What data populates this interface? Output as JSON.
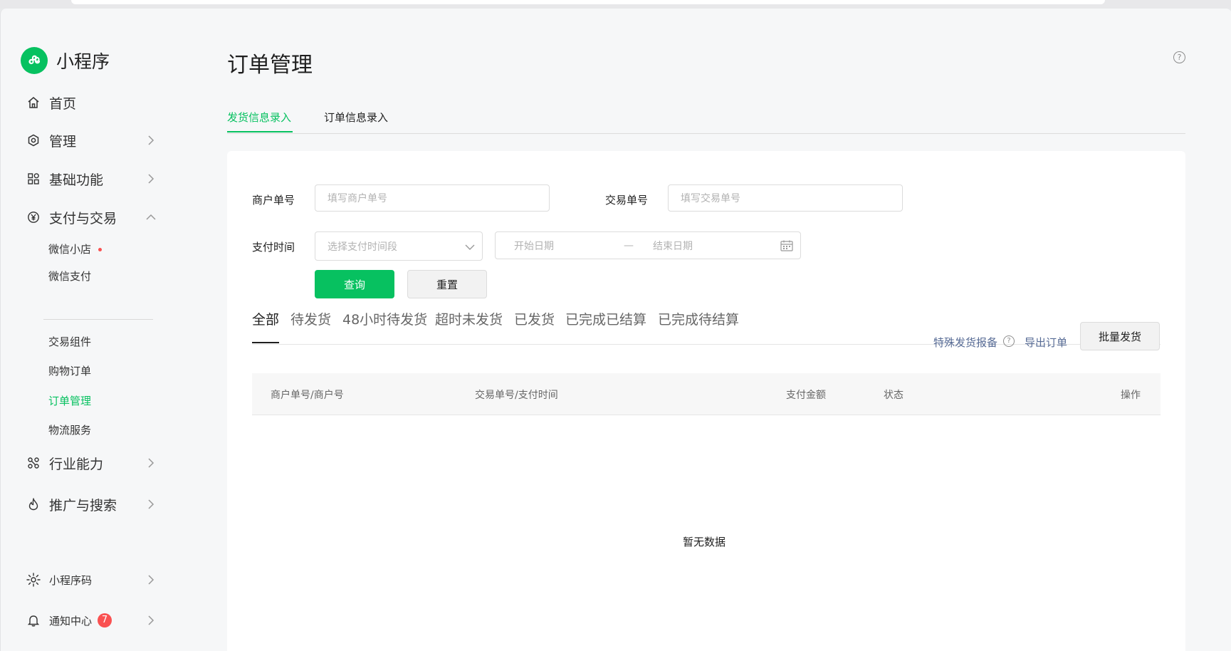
{
  "app": {
    "name": "小程序"
  },
  "sidebar": {
    "items": [
      {
        "label": "首页",
        "icon": "home-icon"
      },
      {
        "label": "管理",
        "icon": "settings-hex-icon"
      },
      {
        "label": "基础功能",
        "icon": "grid-icon"
      },
      {
        "label": "支付与交易",
        "icon": "yuan-circle-icon",
        "expanded": true
      }
    ],
    "payment_sub": [
      {
        "label": "微信小店",
        "dot": true
      },
      {
        "label": "微信支付"
      }
    ],
    "trade_sub": [
      {
        "label": "交易组件"
      },
      {
        "label": "购物订单"
      },
      {
        "label": "订单管理",
        "active": true
      },
      {
        "label": "物流服务"
      }
    ],
    "more_items": [
      {
        "label": "行业能力",
        "icon": "industry-icon"
      },
      {
        "label": "推广与搜索",
        "icon": "flame-icon"
      }
    ],
    "bottom": {
      "qrcode_label": "小程序码",
      "notify_label": "通知中心",
      "notify_count": "7"
    }
  },
  "main": {
    "title": "订单管理",
    "help": "?",
    "tabs": [
      {
        "label": "发货信息录入",
        "active": true
      },
      {
        "label": "订单信息录入"
      }
    ],
    "form": {
      "merchant_label": "商户单号",
      "merchant_placeholder": "填写商户单号",
      "trade_label": "交易单号",
      "trade_placeholder": "填写交易单号",
      "paytime_label": "支付时间",
      "paytime_select": "选择支付时间段",
      "start_date": "开始日期",
      "range_sep": "—",
      "end_date": "结束日期",
      "query_btn": "查询",
      "reset_btn": "重置"
    },
    "filter_tabs": [
      {
        "label": "全部",
        "active": true
      },
      {
        "label": "待发货"
      },
      {
        "label": "48小时待发货"
      },
      {
        "label": "超时未发货"
      },
      {
        "label": "已发货"
      },
      {
        "label": "已完成已结算"
      },
      {
        "label": "已完成待结算"
      }
    ],
    "actions": {
      "special_report": "特殊发货报备",
      "help": "?",
      "export": "导出订单",
      "batch_ship": "批量发货"
    },
    "table": {
      "columns": [
        "商户单号/商户号",
        "交易单号/支付时间",
        "支付金额",
        "状态",
        "操作"
      ],
      "empty_text": "暂无数据"
    }
  },
  "colors": {
    "accent": "#07c160",
    "link": "#576b95",
    "badge": "#fa5151"
  }
}
